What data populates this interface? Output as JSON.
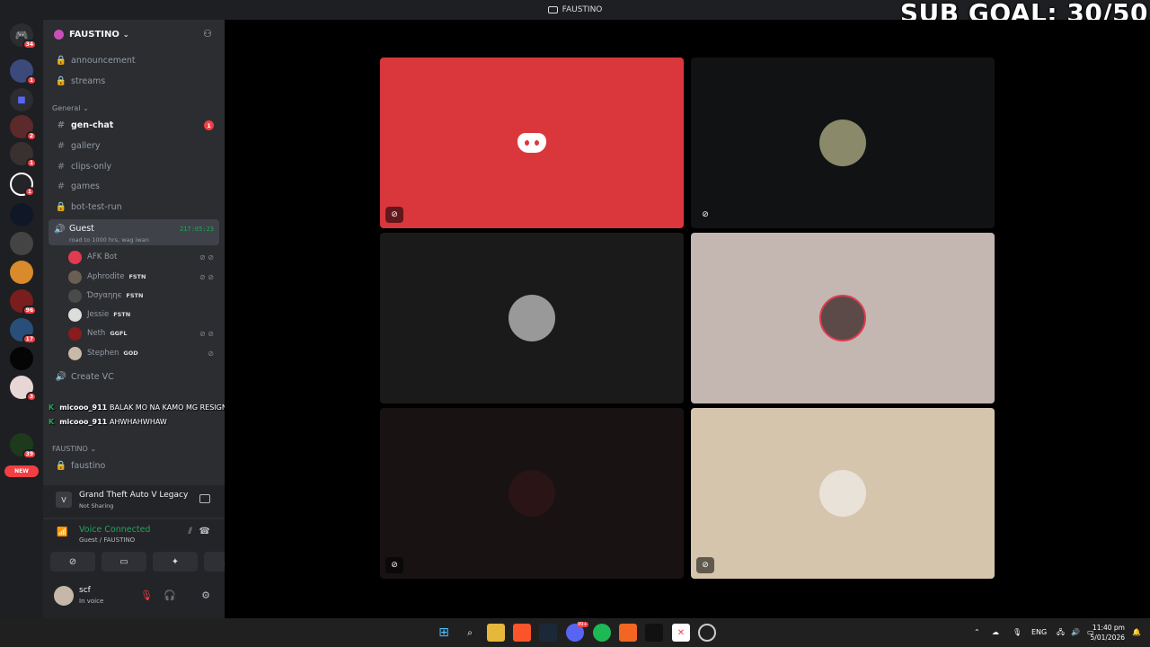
{
  "window": {
    "title": "FAUSTINO"
  },
  "overlay": {
    "sub_goal": "SUB GOAL: 30/50"
  },
  "servers": {
    "badges": [
      "34",
      "1",
      "2",
      "1",
      "1",
      "1",
      "2",
      "96",
      "17",
      "3",
      "39"
    ],
    "new_label": "NEW"
  },
  "guild": {
    "name": "FAUSTINO"
  },
  "channels": {
    "top": [
      {
        "name": "announcement",
        "type": "locked"
      },
      {
        "name": "streams",
        "type": "locked"
      }
    ],
    "general_category": "General",
    "general": [
      {
        "name": "gen-chat",
        "type": "text",
        "unread": "1"
      },
      {
        "name": "gallery",
        "type": "text"
      },
      {
        "name": "clips-only",
        "type": "text"
      },
      {
        "name": "games",
        "type": "text"
      },
      {
        "name": "bot-test-run",
        "type": "locked"
      }
    ],
    "voice": {
      "name": "Guest",
      "status": "road to 1000 hrs, wag iwan",
      "timer": "217:05:23",
      "members": [
        {
          "name": "AFK Bot",
          "tag": "",
          "color": "#e03c50"
        },
        {
          "name": "Aphrodite",
          "tag": "FSTN",
          "color": "#6a5e55"
        },
        {
          "name": "Ɗσуαηηє",
          "tag": "FSTN",
          "color": "#4a4a4a"
        },
        {
          "name": "Jessie",
          "tag": "FSTN",
          "color": "#ddd"
        },
        {
          "name": "Neth",
          "tag": "GGFL",
          "color": "#8a1c1c"
        },
        {
          "name": "Stephen",
          "tag": "GOD",
          "color": "#c9b9a8"
        }
      ]
    },
    "create_vc": "Create VC",
    "chat_overlay": [
      {
        "user": "micooo_911",
        "message": "BALAK MO NA KAMO MG RESIGN"
      },
      {
        "user": "micooo_911",
        "message": "AHWHAHWHAW"
      }
    ],
    "faustino_category": "FAUSTINO",
    "faustino": [
      {
        "name": "faustino",
        "type": "locked"
      }
    ]
  },
  "activity": {
    "game": "Grand Theft Auto V Legacy",
    "status": "Not Sharing"
  },
  "voice_connection": {
    "label": "Voice Connected",
    "location": "Guest / FAUSTINO"
  },
  "user": {
    "name": "scf",
    "status": "In voice"
  },
  "stage": {
    "tiles": [
      {
        "bg": "#da373c",
        "kind": "discord-logo",
        "muted": true
      },
      {
        "bg": "#111214",
        "kind": "avatar",
        "muted": true
      },
      {
        "bg": "#1a1a1b",
        "kind": "avatar",
        "muted": false
      },
      {
        "bg": "#c4b6b0",
        "kind": "avatar",
        "muted": false
      },
      {
        "bg": "#181213",
        "kind": "avatar",
        "muted": true
      },
      {
        "bg": "#d6c5ad",
        "kind": "avatar",
        "muted": true
      }
    ]
  },
  "taskbar": {
    "lang": "ENG",
    "time": "11:40 pm",
    "date": "5/01/2026",
    "discord_badge": "99+"
  }
}
